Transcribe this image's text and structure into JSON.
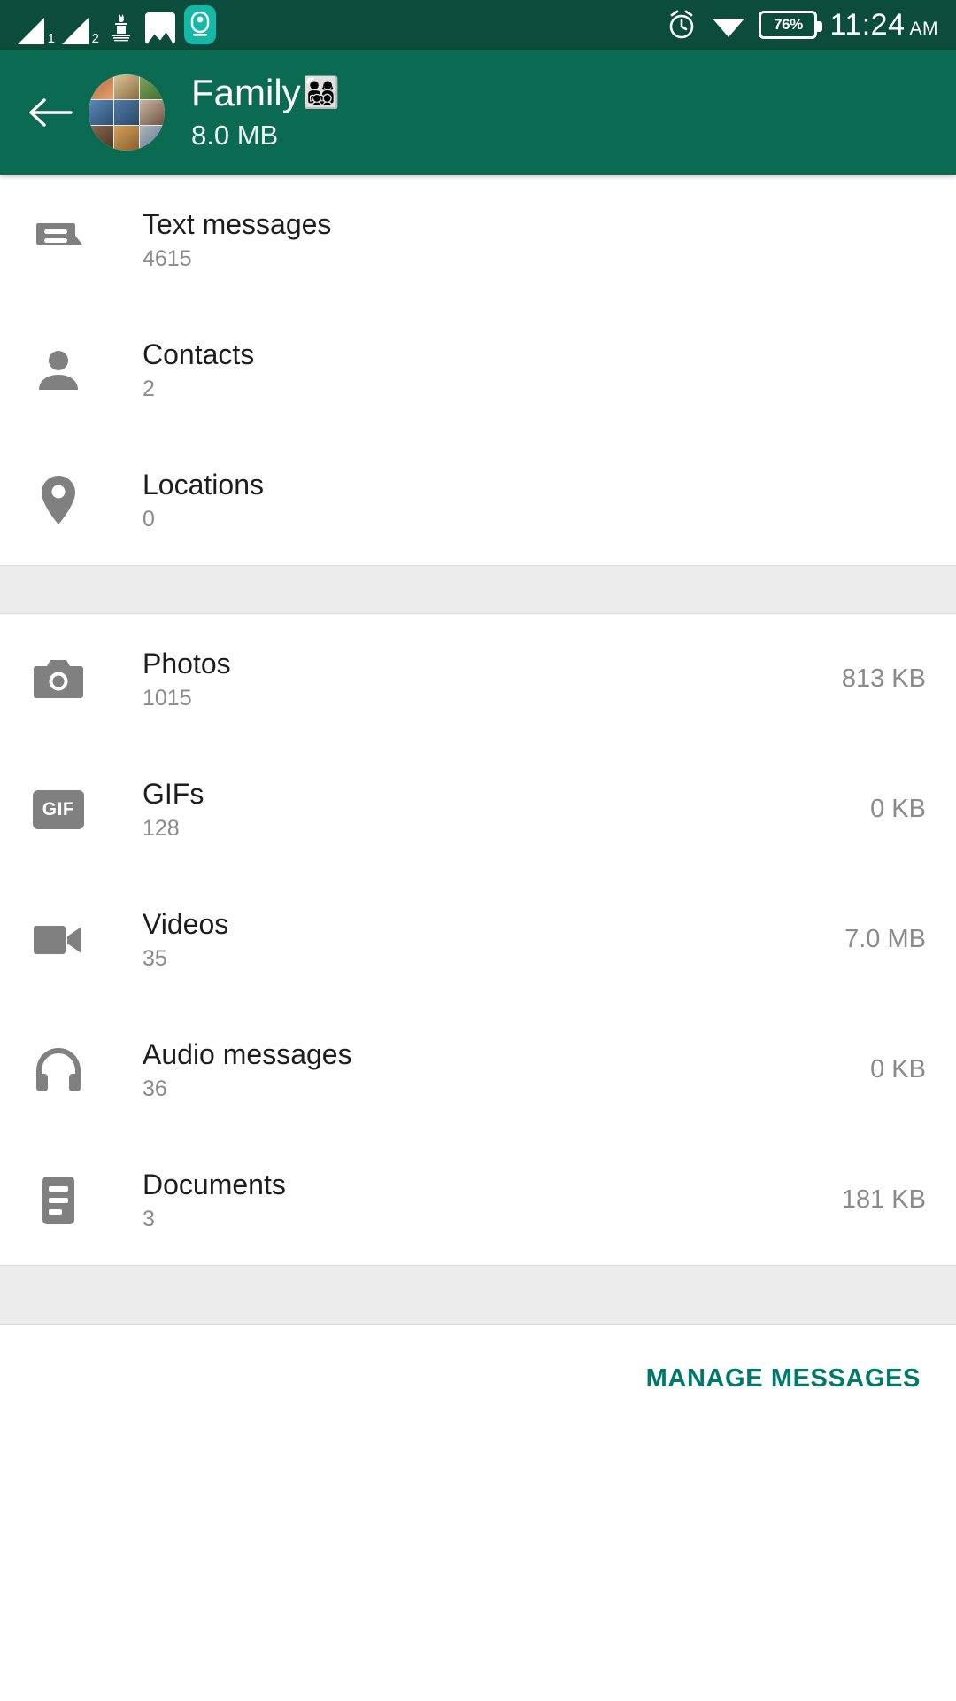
{
  "status_bar": {
    "signal_1_label": "1",
    "signal_2_label": "2",
    "emblem_icon": "government-emblem-icon",
    "gallery_icon": "gallery-icon",
    "badge_icon": "location-badge-icon",
    "alarm_icon": "alarm-clock-icon",
    "wifi_icon": "wifi-icon",
    "battery_percent": "76%",
    "time": "11:24",
    "meridiem": "AM"
  },
  "app_bar": {
    "back_icon": "back-arrow-icon",
    "avatar_icon": "group-avatar-collage",
    "title": "Family",
    "title_emoji": "👨‍👩‍👧‍👦",
    "subtitle": "8.0 MB"
  },
  "sections": [
    {
      "rows": [
        {
          "icon": "text-messages-icon",
          "label": "Text messages",
          "count": "4615",
          "size": ""
        },
        {
          "icon": "contacts-icon",
          "label": "Contacts",
          "count": "2",
          "size": ""
        },
        {
          "icon": "locations-icon",
          "label": "Locations",
          "count": "0",
          "size": ""
        }
      ]
    },
    {
      "rows": [
        {
          "icon": "photos-icon",
          "label": "Photos",
          "count": "1015",
          "size": "813 KB"
        },
        {
          "icon": "gif-icon",
          "label": "GIFs",
          "count": "128",
          "size": "0 KB"
        },
        {
          "icon": "videos-icon",
          "label": "Videos",
          "count": "35",
          "size": "7.0 MB"
        },
        {
          "icon": "audio-messages-icon",
          "label": "Audio messages",
          "count": "36",
          "size": "0 KB"
        },
        {
          "icon": "documents-icon",
          "label": "Documents",
          "count": "3",
          "size": "181 KB"
        }
      ]
    }
  ],
  "footer": {
    "manage_label": "MANAGE MESSAGES"
  },
  "colors": {
    "status_bar": "#0c4c3d",
    "app_bar": "#0b6b52",
    "accent": "#00796b",
    "icon_gray": "#808080",
    "divider_gray": "#ececec"
  },
  "gif_badge_text": "GIF"
}
